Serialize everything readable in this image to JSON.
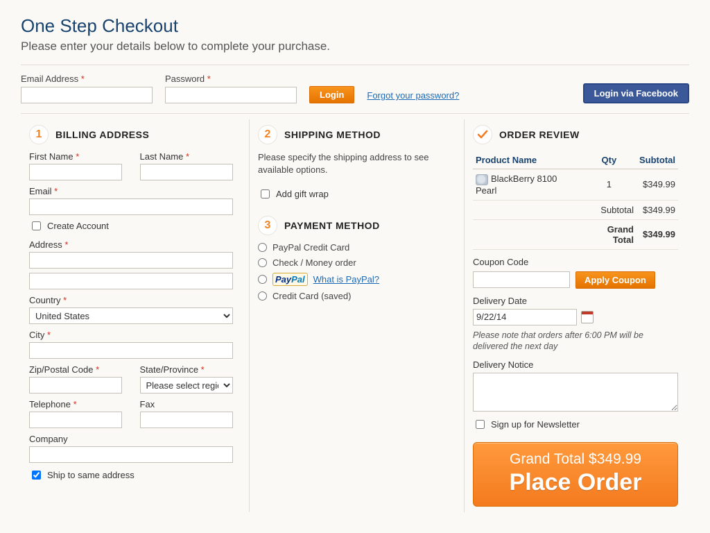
{
  "header": {
    "title": "One Step Checkout",
    "subtitle": "Please enter your details below to complete your purchase."
  },
  "login": {
    "email_label": "Email Address",
    "password_label": "Password",
    "login_btn": "Login",
    "forgot_link": "Forgot your password?",
    "fb_btn": "Login via Facebook"
  },
  "billing": {
    "title": "BILLING ADDRESS",
    "num": "1",
    "first_name": "First Name",
    "last_name": "Last Name",
    "email": "Email",
    "create_account": "Create Account",
    "address": "Address",
    "country": "Country",
    "country_value": "United States",
    "city": "City",
    "zip": "Zip/Postal Code",
    "state": "State/Province",
    "state_placeholder": "Please select region",
    "telephone": "Telephone",
    "fax": "Fax",
    "company": "Company",
    "ship_same": "Ship to same address"
  },
  "shipping": {
    "title": "SHIPPING METHOD",
    "num": "2",
    "msg": "Please specify the shipping address to see available options.",
    "gift_wrap": "Add gift wrap"
  },
  "payment": {
    "title": "PAYMENT METHOD",
    "num": "3",
    "opt1": "PayPal Credit Card",
    "opt2": "Check / Money order",
    "paypal_p1": "Pay",
    "paypal_p2": "Pal",
    "what_is": "What is PayPal?",
    "opt4": "Credit Card (saved)"
  },
  "review": {
    "title": "ORDER REVIEW",
    "hdr_product": "Product Name",
    "hdr_qty": "Qty",
    "hdr_subtotal": "Subtotal",
    "product": "BlackBerry 8100 Pearl",
    "qty": "1",
    "price": "$349.99",
    "subtotal_label": "Subtotal",
    "subtotal": "$349.99",
    "grand_label": "Grand Total",
    "grand": "$349.99",
    "coupon_label": "Coupon Code",
    "apply_btn": "Apply Coupon",
    "delivery_date_label": "Delivery Date",
    "delivery_date": "9/22/14",
    "delivery_note": "Please note that orders after 6:00 PM will be delivered the next day",
    "delivery_notice_label": "Delivery Notice",
    "newsletter": "Sign up for Newsletter",
    "place_gt_prefix": "Grand Total ",
    "place_gt_amount": "$349.99",
    "place_order": "Place Order"
  }
}
